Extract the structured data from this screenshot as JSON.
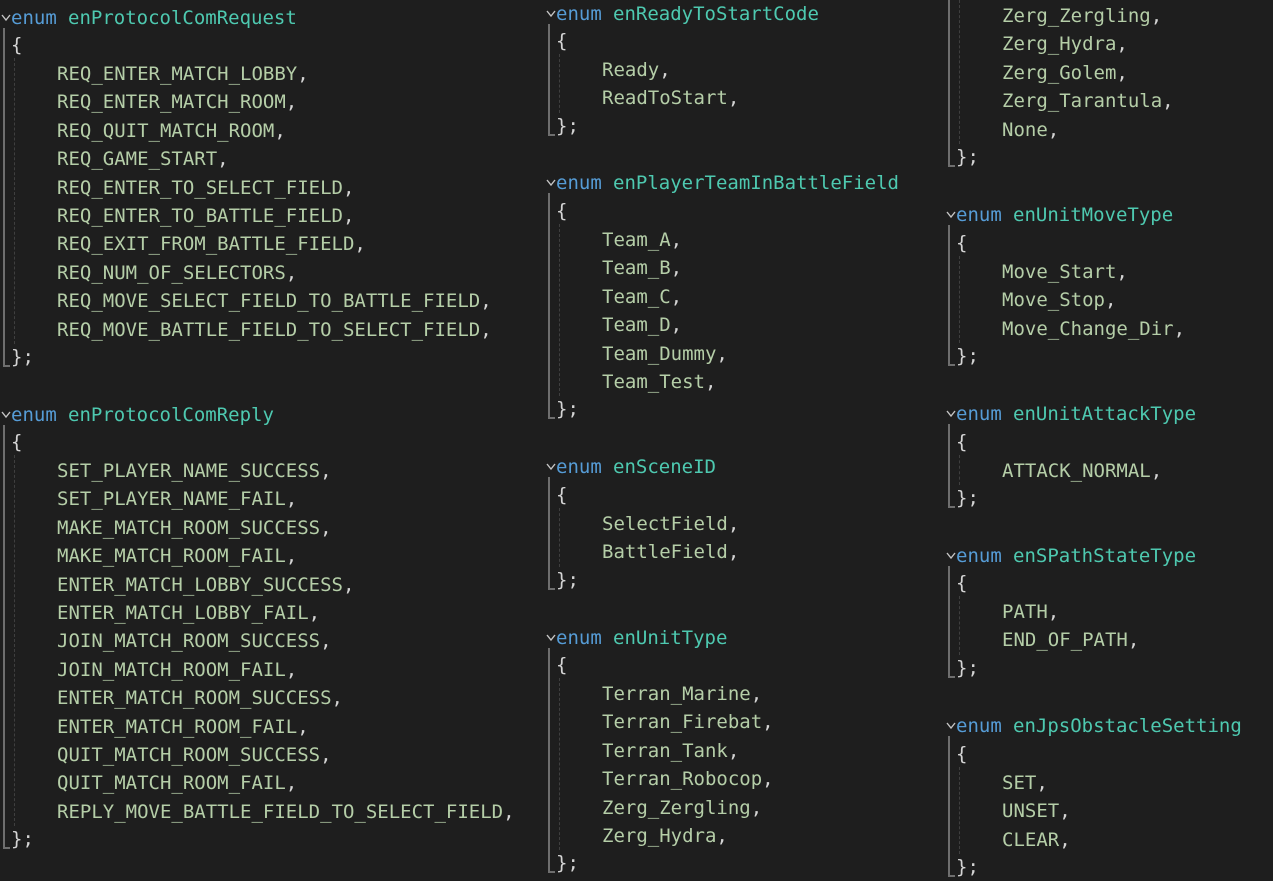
{
  "editor": {
    "theme_colors": {
      "background": "#1e1e1e",
      "keyword": "#569cd6",
      "type_name": "#4ec9b0",
      "enum_member": "#b5cea8",
      "punctuation": "#d4d4d4"
    },
    "keyword": "enum",
    "brace_open": "{",
    "brace_close": "};",
    "separator": ","
  },
  "columns": [
    {
      "enums": [
        {
          "name": "enProtocolComRequest",
          "members": [
            "REQ_ENTER_MATCH_LOBBY",
            "REQ_ENTER_MATCH_ROOM",
            "REQ_QUIT_MATCH_ROOM",
            "REQ_GAME_START",
            "REQ_ENTER_TO_SELECT_FIELD",
            "REQ_ENTER_TO_BATTLE_FIELD",
            "REQ_EXIT_FROM_BATTLE_FIELD",
            "REQ_NUM_OF_SELECTORS",
            "REQ_MOVE_SELECT_FIELD_TO_BATTLE_FIELD",
            "REQ_MOVE_BATTLE_FIELD_TO_SELECT_FIELD"
          ]
        },
        {
          "name": "enProtocolComReply",
          "members": [
            "SET_PLAYER_NAME_SUCCESS",
            "SET_PLAYER_NAME_FAIL",
            "MAKE_MATCH_ROOM_SUCCESS",
            "MAKE_MATCH_ROOM_FAIL",
            "ENTER_MATCH_LOBBY_SUCCESS",
            "ENTER_MATCH_LOBBY_FAIL",
            "JOIN_MATCH_ROOM_SUCCESS",
            "JOIN_MATCH_ROOM_FAIL",
            "ENTER_MATCH_ROOM_SUCCESS",
            "ENTER_MATCH_ROOM_FAIL",
            "QUIT_MATCH_ROOM_SUCCESS",
            "QUIT_MATCH_ROOM_FAIL",
            "REPLY_MOVE_BATTLE_FIELD_TO_SELECT_FIELD"
          ]
        }
      ]
    },
    {
      "enums": [
        {
          "name": "enReadyToStartCode",
          "members": [
            "Ready",
            "ReadToStart"
          ]
        },
        {
          "name": "enPlayerTeamInBattleField",
          "members": [
            "Team_A",
            "Team_B",
            "Team_C",
            "Team_D",
            "Team_Dummy",
            "Team_Test"
          ]
        },
        {
          "name": "enSceneID",
          "members": [
            "SelectField",
            "BattleField"
          ]
        },
        {
          "name": "enUnitType",
          "members": [
            "Terran_Marine",
            "Terran_Firebat",
            "Terran_Tank",
            "Terran_Robocop",
            "Zerg_Zergling",
            "Zerg_Hydra"
          ]
        }
      ]
    },
    {
      "enums": [
        {
          "name": "",
          "members": [
            "Zerg_Zergling",
            "Zerg_Hydra",
            "Zerg_Golem",
            "Zerg_Tarantula",
            "None"
          ]
        },
        {
          "name": "enUnitMoveType",
          "members": [
            "Move_Start",
            "Move_Stop",
            "Move_Change_Dir"
          ]
        },
        {
          "name": "enUnitAttackType",
          "members": [
            "ATTACK_NORMAL"
          ]
        },
        {
          "name": "enSPathStateType",
          "members": [
            "PATH",
            "END_OF_PATH"
          ]
        },
        {
          "name": "enJpsObstacleSetting",
          "members": [
            "SET",
            "UNSET",
            "CLEAR"
          ]
        }
      ]
    }
  ]
}
